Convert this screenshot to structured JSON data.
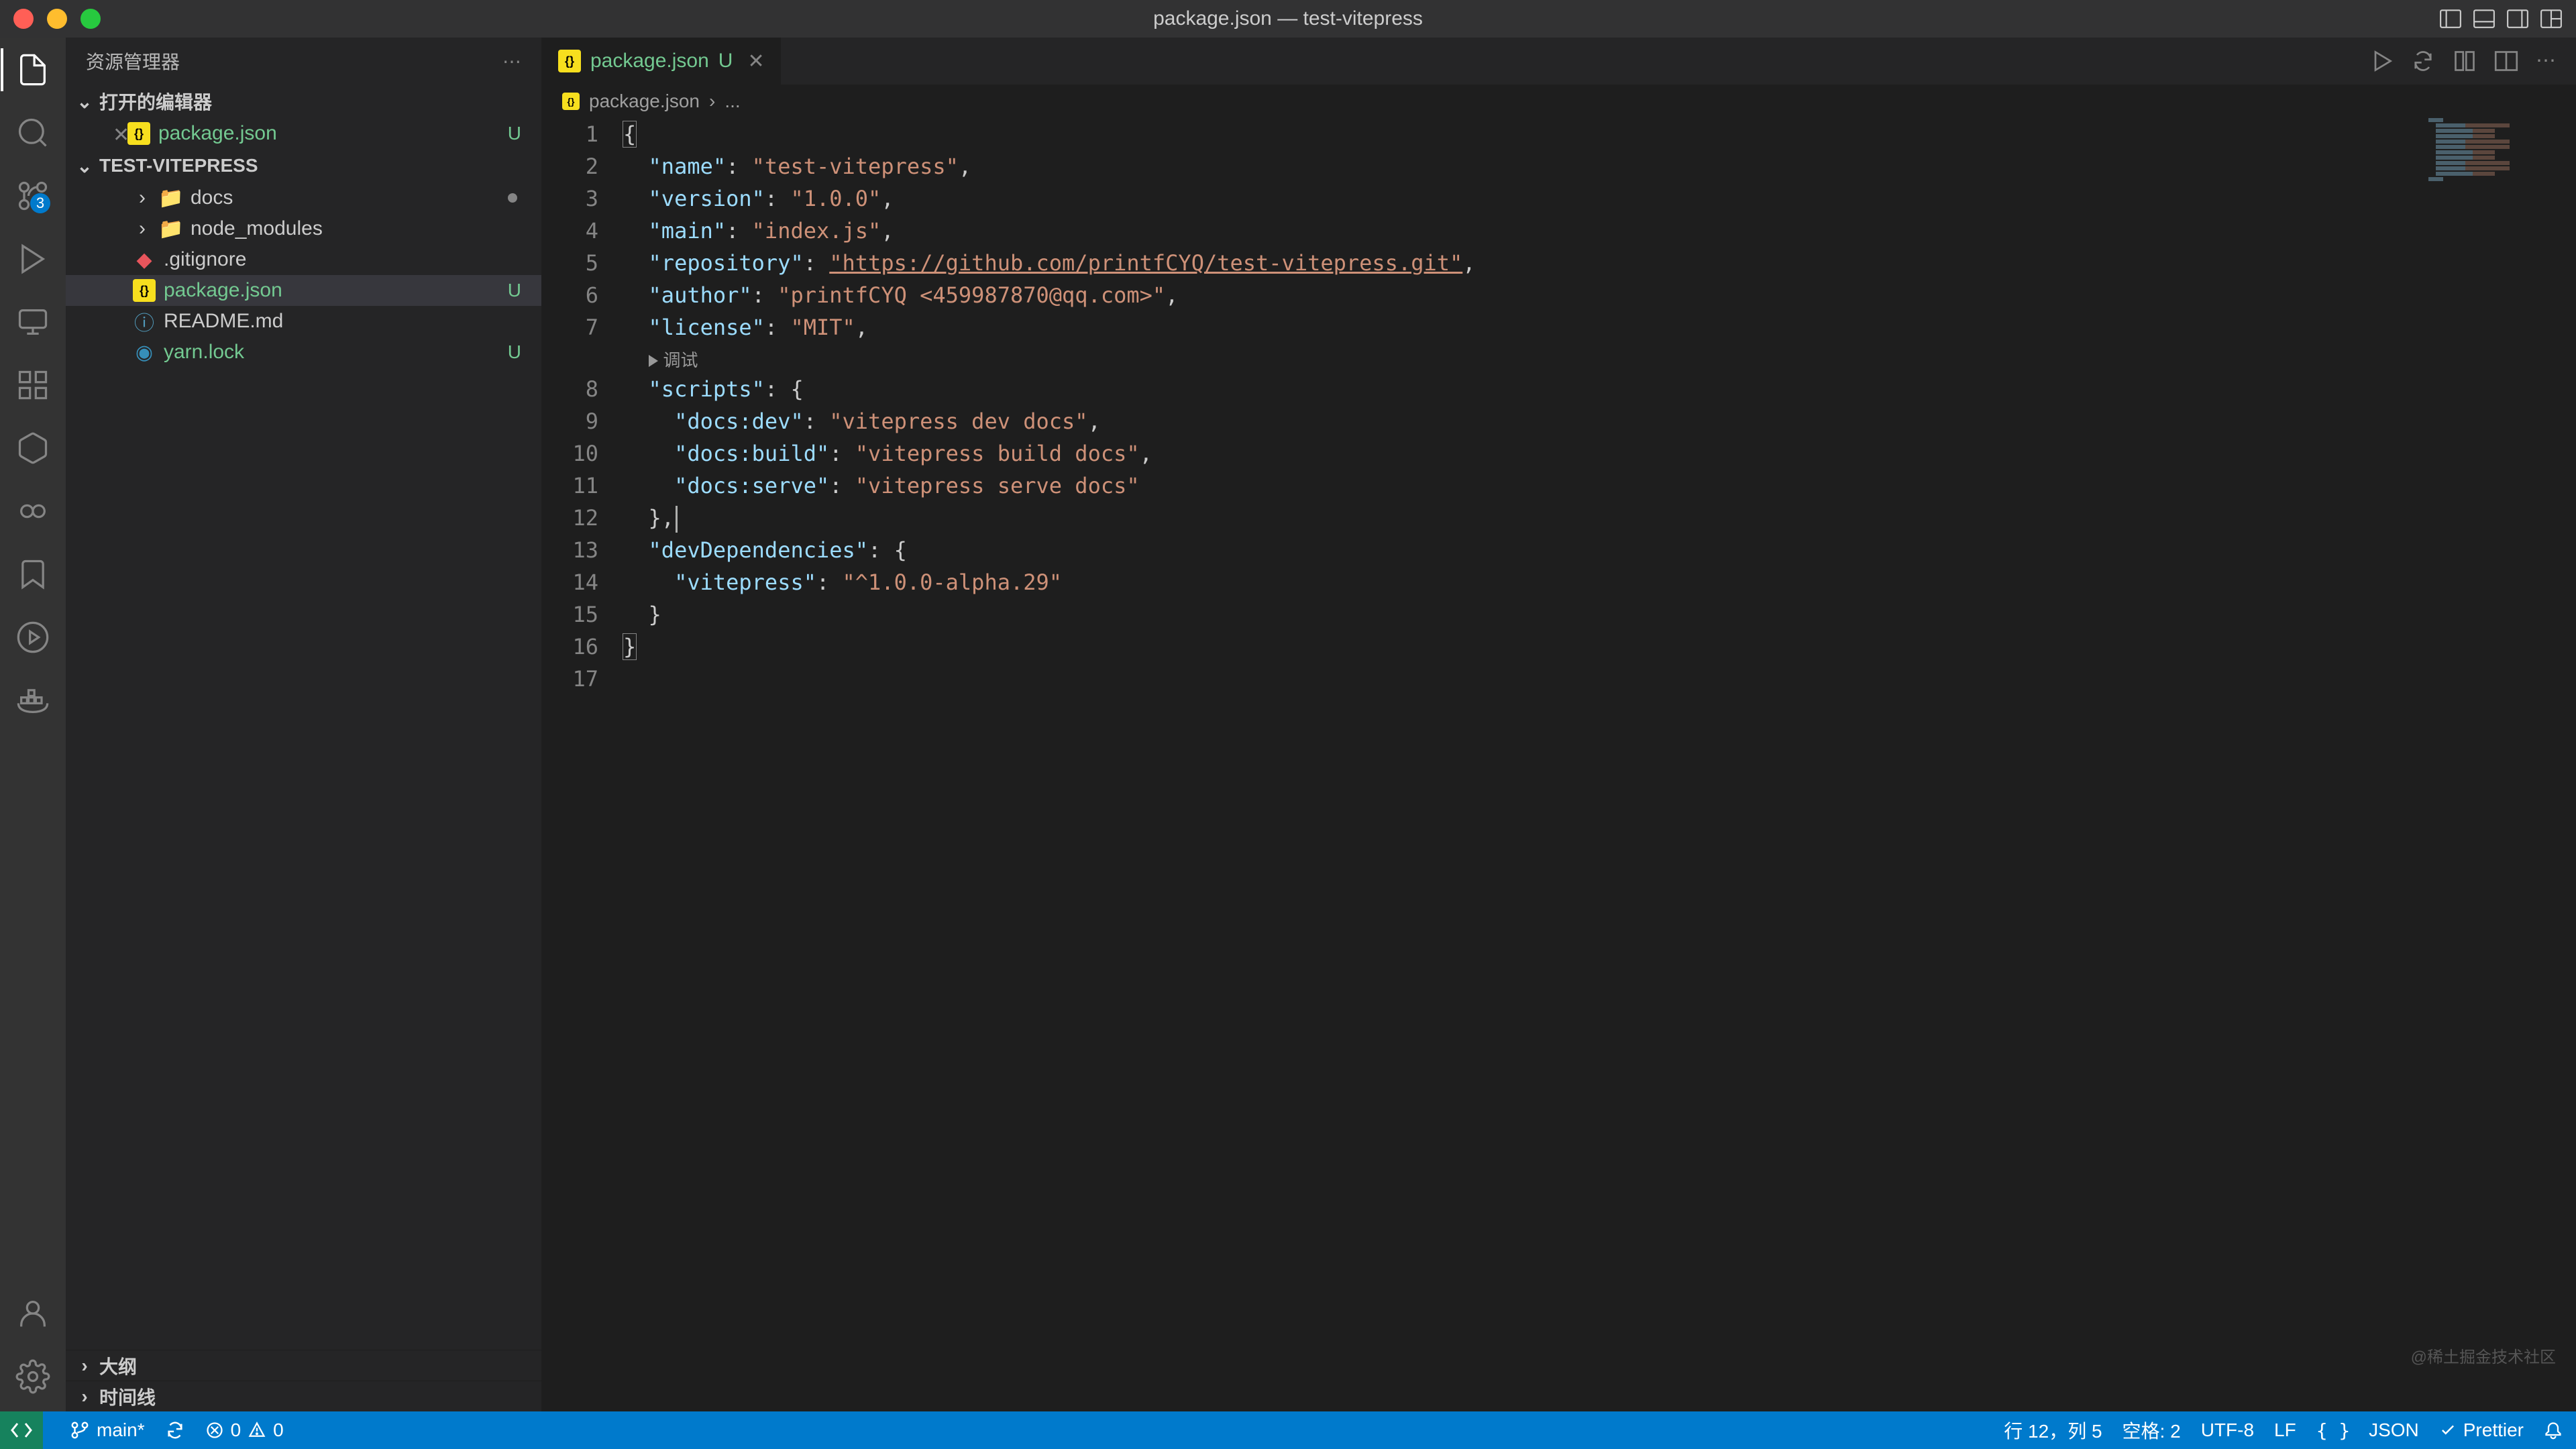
{
  "title": "package.json — test-vitepress",
  "sidebar": {
    "header": "资源管理器",
    "openEditors": "打开的编辑器",
    "project": "TEST-VITEPRESS",
    "outline": "大纲",
    "timeline": "时间线",
    "tree": {
      "editor0": "package.json",
      "editor0_status": "U",
      "docs": "docs",
      "node_modules": "node_modules",
      "gitignore": ".gitignore",
      "package": "package.json",
      "package_status": "U",
      "readme": "README.md",
      "yarn": "yarn.lock",
      "yarn_status": "U"
    }
  },
  "tab": {
    "name": "package.json",
    "status": "U"
  },
  "breadcrumb": {
    "file": "package.json",
    "more": "..."
  },
  "code": {
    "l2_key": "\"name\"",
    "l2_val": "\"test-vitepress\"",
    "l3_key": "\"version\"",
    "l3_val": "\"1.0.0\"",
    "l4_key": "\"main\"",
    "l4_val": "\"index.js\"",
    "l5_key": "\"repository\"",
    "l5_val": "\"https://github.com/printfCYQ/test-vitepress.git\"",
    "l6_key": "\"author\"",
    "l6_val": "\"printfCYQ <459987870@qq.com>\"",
    "l7_key": "\"license\"",
    "l7_val": "\"MIT\"",
    "lens": "调试",
    "l8_key": "\"scripts\"",
    "l9_key": "\"docs:dev\"",
    "l9_val": "\"vitepress dev docs\"",
    "l10_key": "\"docs:build\"",
    "l10_val": "\"vitepress build docs\"",
    "l11_key": "\"docs:serve\"",
    "l11_val": "\"vitepress serve docs\"",
    "l13_key": "\"devDependencies\"",
    "l14_key": "\"vitepress\"",
    "l14_val": "\"^1.0.0-alpha.29\""
  },
  "status": {
    "branch": "main*",
    "sync": "",
    "errors": "0",
    "warnings": "0",
    "line_col": "行 12，列 5",
    "spaces": "空格: 2",
    "encoding": "UTF-8",
    "eol": "LF",
    "lang": "JSON",
    "formatter": "Prettier"
  },
  "scm_badge": "3",
  "watermark": "@稀土掘金技术社区"
}
